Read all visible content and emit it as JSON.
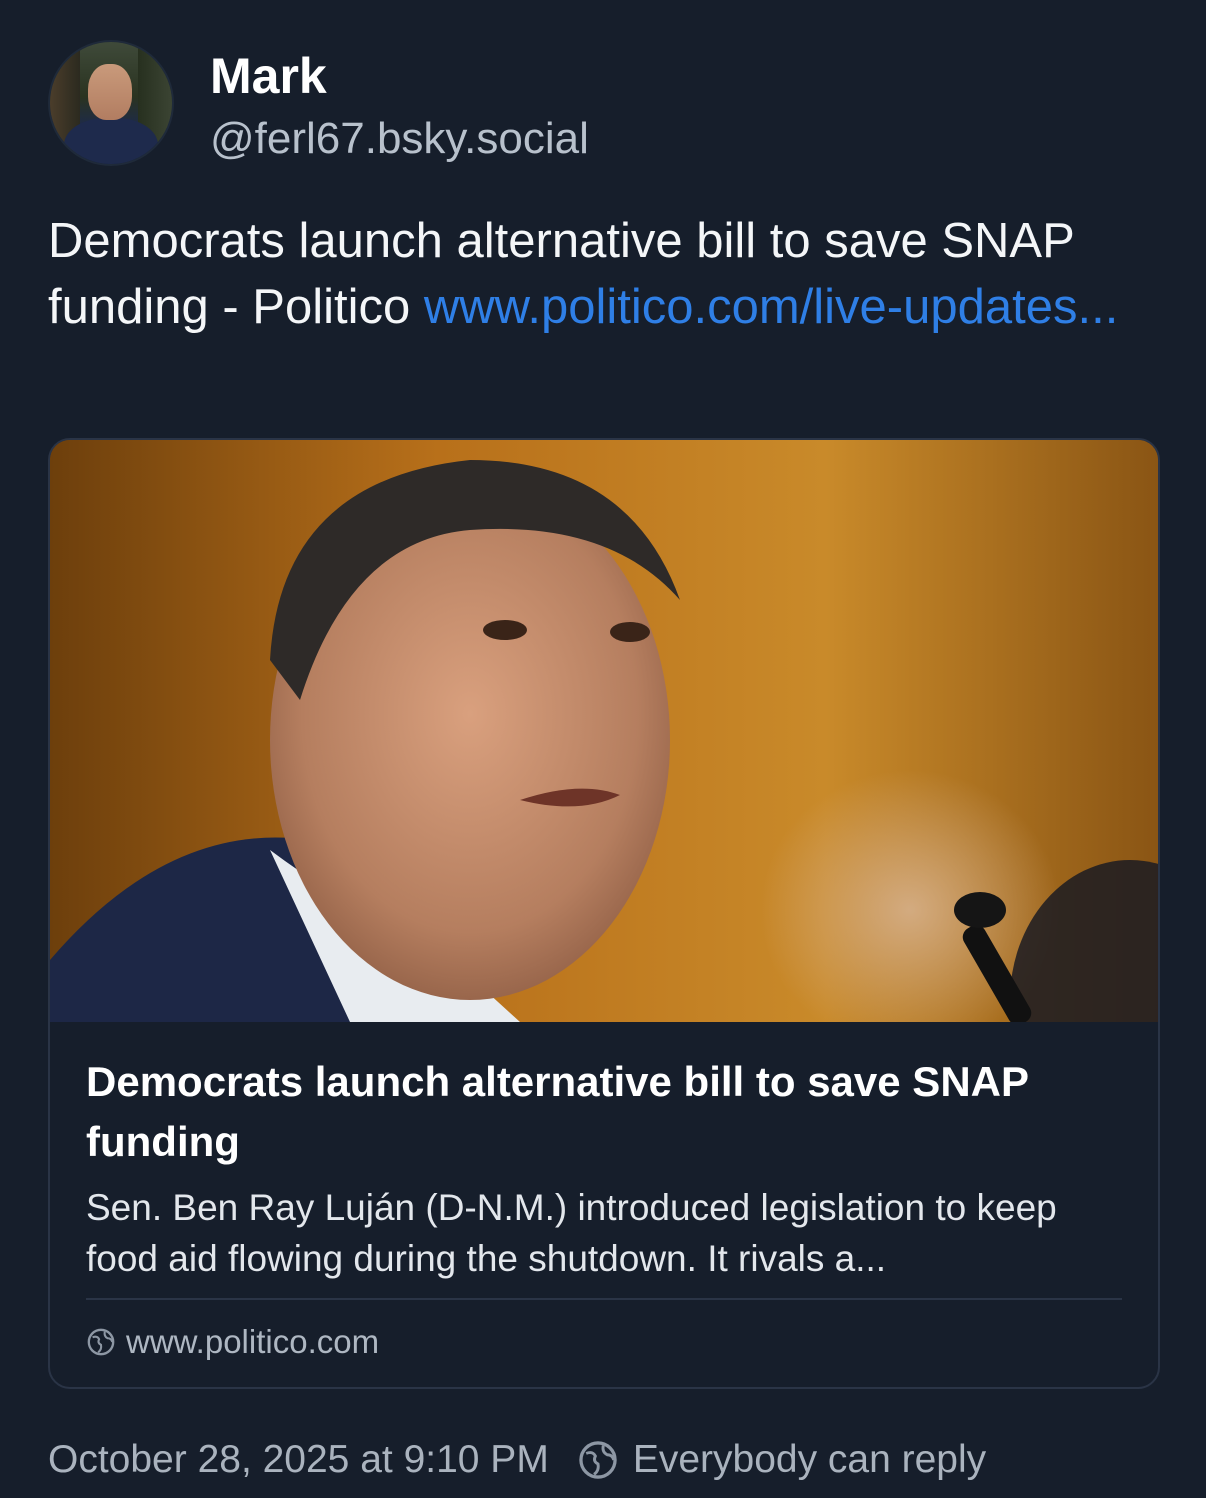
{
  "author": {
    "display_name": "Mark",
    "handle": "@ferl67.bsky.social"
  },
  "post": {
    "text": "Democrats launch alternative bill to save SNAP funding - Politico ",
    "link_text": "www.politico.com/​live-updates..."
  },
  "embed": {
    "title": "Democrats launch alternative bill to save SNAP funding",
    "description": "Sen. Ben Ray Luján (D-N.M.) introduced legislation to keep food aid flowing during the shutdown. It rivals a...",
    "domain": "www.politico.com",
    "domain_icon": "globe-icon"
  },
  "footer": {
    "timestamp": "October 28, 2025 at 9:10 PM",
    "reply_setting": "Everybody can reply",
    "reply_icon": "globe-icon"
  },
  "colors": {
    "background": "#161e2b",
    "link": "#2f7fe6",
    "border": "#2a3446"
  }
}
